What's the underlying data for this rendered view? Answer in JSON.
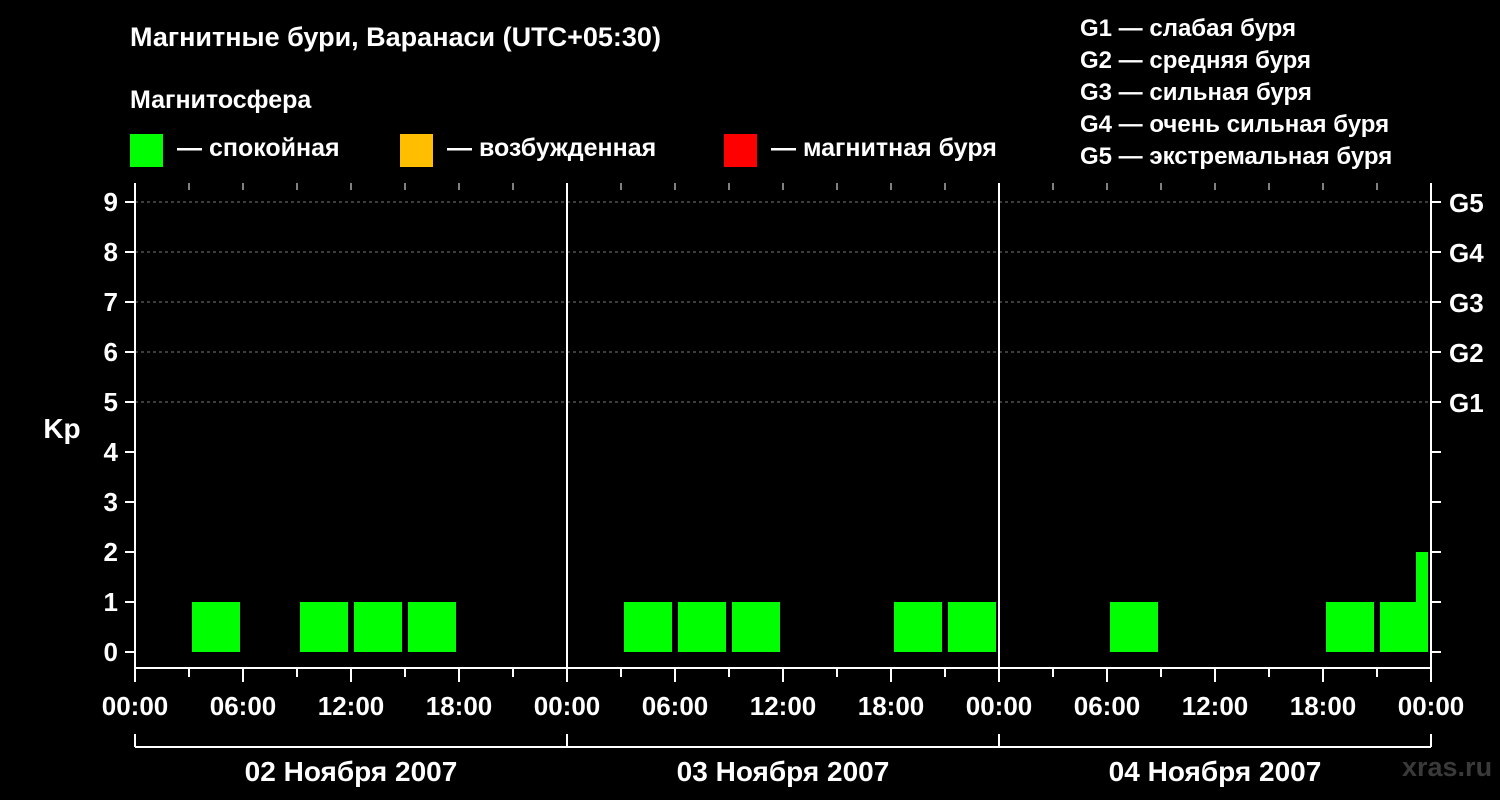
{
  "header": {
    "title": "Магнитные бури, Варанаси (UTC+05:30)",
    "magnetosphere_label": "Магнитосфера"
  },
  "legend": [
    {
      "label": "— спокойная",
      "color": "#00ff00"
    },
    {
      "label": "— возбужденная",
      "color": "#ffbf00"
    },
    {
      "label": "— магнитная буря",
      "color": "#ff0000"
    }
  ],
  "g_scale": [
    "G1 — слабая буря",
    "G2 — средняя буря",
    "G3 — сильная буря",
    "G4 — очень сильная буря",
    "G5 — экстремальная буря"
  ],
  "watermark": "xras.ru",
  "chart_data": {
    "type": "bar",
    "ylabel": "Kp",
    "ylim": [
      0,
      9
    ],
    "y_ticks": [
      "0",
      "1",
      "2",
      "3",
      "4",
      "5",
      "6",
      "7",
      "8",
      "9"
    ],
    "right_ticks": [
      {
        "kp": 5,
        "label": "G1"
      },
      {
        "kp": 6,
        "label": "G2"
      },
      {
        "kp": 7,
        "label": "G3"
      },
      {
        "kp": 8,
        "label": "G4"
      },
      {
        "kp": 9,
        "label": "G5"
      }
    ],
    "x_tick_labels": [
      "00:00",
      "06:00",
      "12:00",
      "18:00",
      "00:00",
      "06:00",
      "12:00",
      "18:00",
      "00:00",
      "06:00",
      "12:00",
      "18:00",
      "00:00"
    ],
    "days": [
      "02 Ноября 2007",
      "03 Ноября 2007",
      "04 Ноября 2007"
    ],
    "bar_interval_hours": 3,
    "series": [
      {
        "day": 0,
        "values": [
          0,
          1,
          0,
          1,
          1,
          1,
          0,
          0
        ]
      },
      {
        "day": 1,
        "values": [
          0,
          1,
          1,
          1,
          0,
          0,
          1,
          1
        ]
      },
      {
        "day": 2,
        "values": [
          0,
          0,
          1,
          0,
          0,
          0,
          1,
          1
        ],
        "partial_last": {
          "value": 2
        }
      }
    ],
    "colors": {
      "quiet": "#00ff00",
      "active": "#ffbf00",
      "storm": "#ff0000"
    },
    "grid": "dashed"
  }
}
